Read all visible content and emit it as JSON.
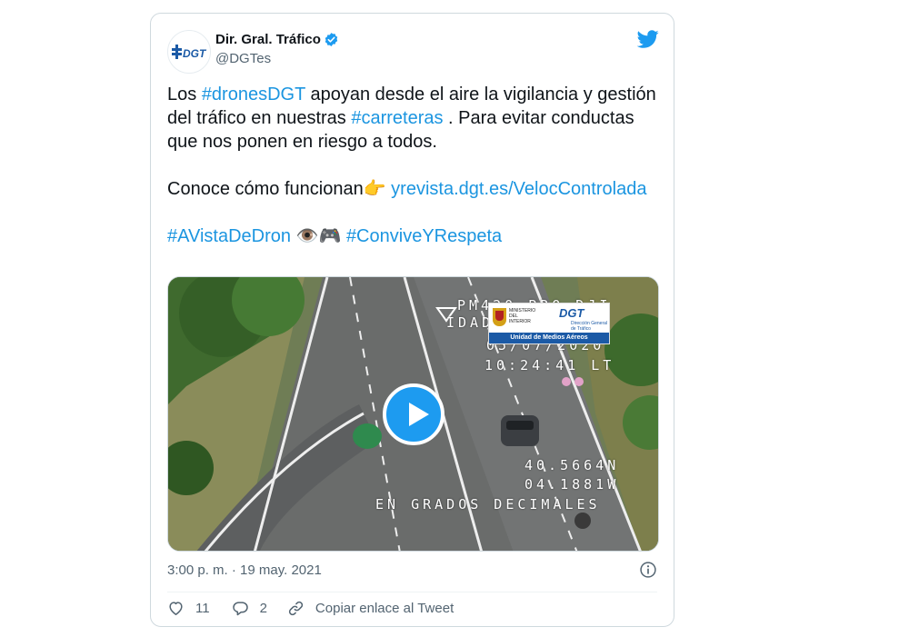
{
  "author": {
    "display_name": "Dir. Gral. Tráfico",
    "handle": "@DGTes",
    "avatar_text": "DGT",
    "verified_icon": "verified-badge-icon",
    "platform_icon": "twitter-bird-icon"
  },
  "tweet": {
    "p1_a": "Los ",
    "p1_tag1": "#dronesDGT",
    "p1_b": " apoyan desde el aire la vigilancia y gestión del tráfico en nuestras ",
    "p1_tag2": "#carreteras",
    "p1_c": " . Para evitar conductas que nos ponen en riesgo a todos.",
    "p2_a": "Conoce cómo funcionan",
    "p2_emoji": "👉",
    "p2_link": "yrevista.dgt.es/VelocControlada",
    "p3_tag1": "#AVistaDeDron",
    "p3_emoji": "👁️🎮",
    "p3_tag2": "#ConviveYRespeta"
  },
  "video": {
    "osd_line1": "PM420 PRO DJI",
    "osd_line2": "IDAD AEREA SJ",
    "osd_date": "05/07/2020",
    "osd_time": "10:24:41 LT",
    "osd_lat": "40.5664N",
    "osd_lon": "04.1881W",
    "osd_units": "EN GRADOS DECIMALES",
    "badge_ministry": "MINISTERIO DEL INTERIOR",
    "badge_dgt": "DGT",
    "badge_dgt_sub": "Dirección General de Tráfico",
    "badge_unit": "Unidad de Medios Aéreos",
    "play_icon": "play-icon"
  },
  "meta": {
    "timestamp": "3:00 p. m. · 19 may. 2021"
  },
  "actions": {
    "likes": "11",
    "replies": "2",
    "copy_link": "Copiar enlace al Tweet"
  },
  "colors": {
    "link": "#1b95e0",
    "twitter_blue": "#1d9bf0",
    "text_muted": "#536471"
  }
}
